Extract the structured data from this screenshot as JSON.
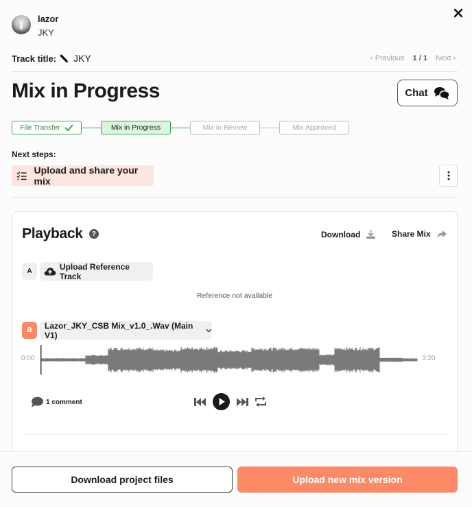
{
  "header": {
    "user_name": "lazor",
    "user_subtitle": "JKY",
    "track_title_label": "Track title:",
    "track_title_value": "JKY",
    "pager": {
      "previous_label": "Previous",
      "count": "1 / 1",
      "next_label": "Next"
    }
  },
  "page_title": "Mix in Progress",
  "chat_label": "Chat",
  "stepper": {
    "steps": [
      {
        "label": "File Transfer",
        "state": "done"
      },
      {
        "label": "Mix in Progress",
        "state": "active"
      },
      {
        "label": "Mix in Review",
        "state": "pending"
      },
      {
        "label": "Mix Approved",
        "state": "pending"
      }
    ]
  },
  "next_steps": {
    "label": "Next steps:",
    "item": "Upload and share your mix"
  },
  "playback": {
    "title": "Playback",
    "help_glyph": "?",
    "download_label": "Download",
    "share_label": "Share Mix",
    "reference": {
      "slot": "A",
      "upload_label": "Upload Reference Track",
      "status": "Reference not available"
    },
    "mix": {
      "slot": "B",
      "file_label": "Lazor_JKY_CSB Mix_v1.0_.Wav (Main V1)",
      "time_start": "0:00",
      "time_end": "3:20",
      "progress": 0
    },
    "comments_label": "1 comment"
  },
  "colors": {
    "accent": "#fd8a67",
    "success": "#3aa455",
    "next_step_bg": "#fde6df"
  },
  "footer": {
    "download_project_label": "Download project files",
    "upload_mix_label": "Upload new mix version"
  }
}
